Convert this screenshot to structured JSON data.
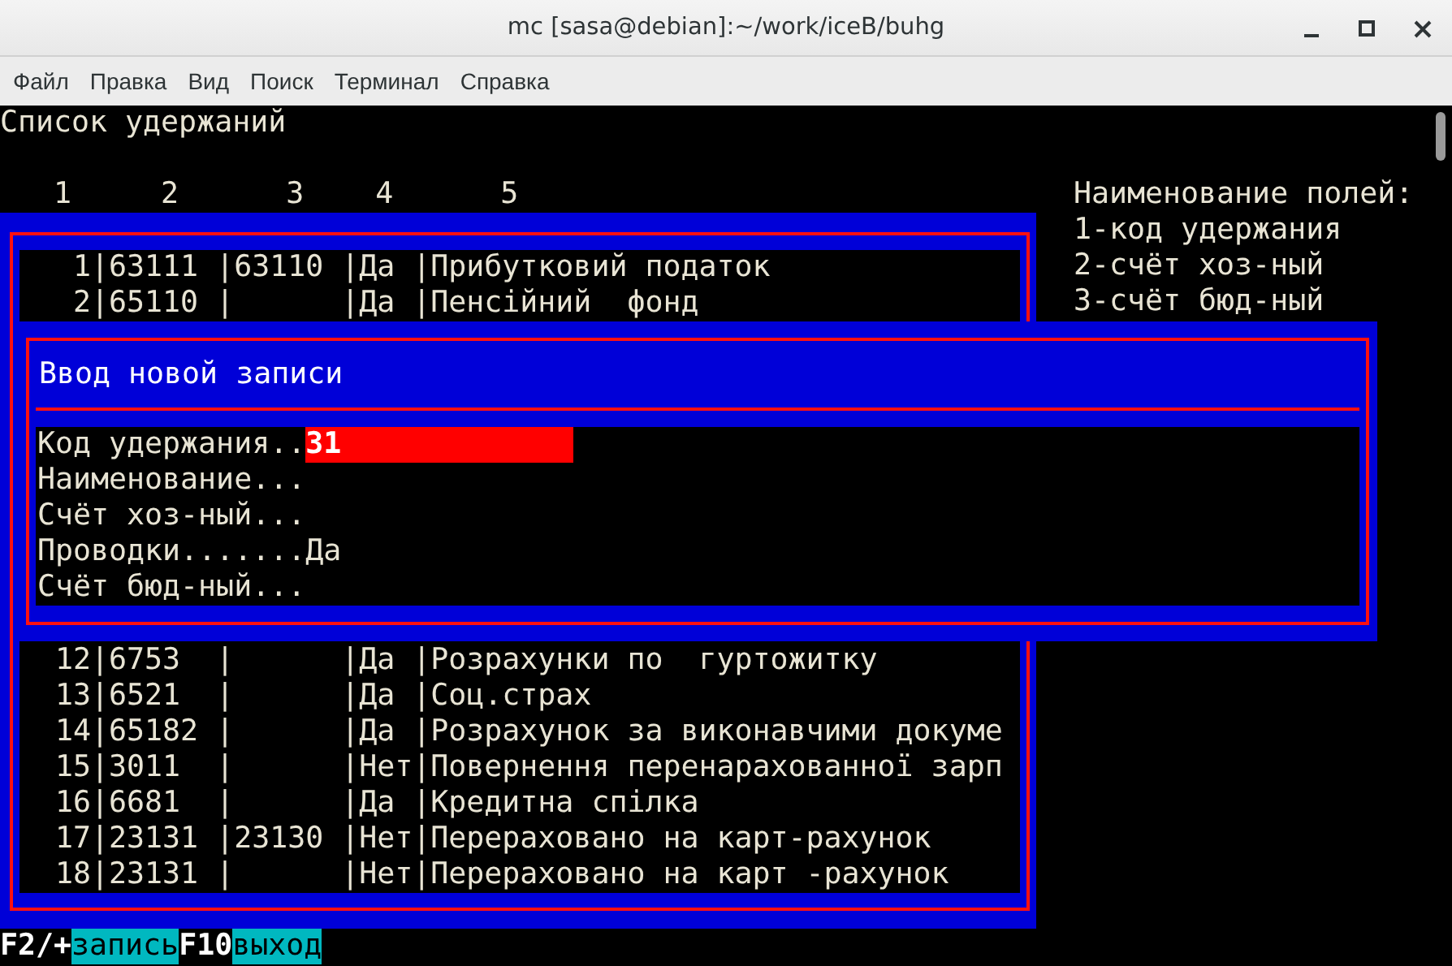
{
  "window": {
    "title": "mc [sasa@debian]:~/work/iceB/buhg"
  },
  "menu": [
    "Файл",
    "Правка",
    "Вид",
    "Поиск",
    "Терминал",
    "Справка"
  ],
  "screen_title": "Список удержаний",
  "column_numbers": [
    "1",
    "2",
    "3",
    "4",
    "5"
  ],
  "legend": [
    "Наименование полей:",
    "1-код удержания",
    "2-счёт хоз-ный",
    "3-счёт бюд-ный"
  ],
  "rows_above_dialog": [
    {
      "number": "1",
      "line": "|63111 |63110 |Да |Прибутковий податок"
    },
    {
      "number": "2",
      "line": "|65110 |      |Да |Пенсійний  фонд"
    }
  ],
  "rows_below_dialog": [
    {
      "number": "12",
      "line": "|6753  |      |Да |Розрахунки по  гуртожитку"
    },
    {
      "number": "13",
      "line": "|6521  |      |Да |Соц.страх"
    },
    {
      "number": "14",
      "line": "|65182 |      |Да |Розрахунок за виконавчими докуме"
    },
    {
      "number": "15",
      "line": "|3011  |      |Нет|Повернення перенарахованної зарп"
    },
    {
      "number": "16",
      "line": "|6681  |      |Да |Кредитна спілка"
    },
    {
      "number": "17",
      "line": "|23131 |23130 |Нет|Перераховано на карт-рахунок"
    },
    {
      "number": "18",
      "line": "|23131 |      |Нет|Перераховано на карт -рахунок"
    }
  ],
  "dialog": {
    "title": "Ввод новой записи",
    "fields": [
      {
        "label": "Код удержания..",
        "value": "31",
        "focused": true
      },
      {
        "label": "Наименование...",
        "focused": false
      },
      {
        "label": "Счёт хоз-ный...",
        "focused": false
      },
      {
        "label": "Проводки.......",
        "value": "Да",
        "focused": false
      },
      {
        "label": "Счёт бюд-ный...",
        "focused": false
      }
    ]
  },
  "hotkeys": [
    {
      "kind": "key",
      "text": "F2/+"
    },
    {
      "kind": "label",
      "text": "запись"
    },
    {
      "kind": "key",
      "text": "F10"
    },
    {
      "kind": "label",
      "text": "выход"
    }
  ]
}
